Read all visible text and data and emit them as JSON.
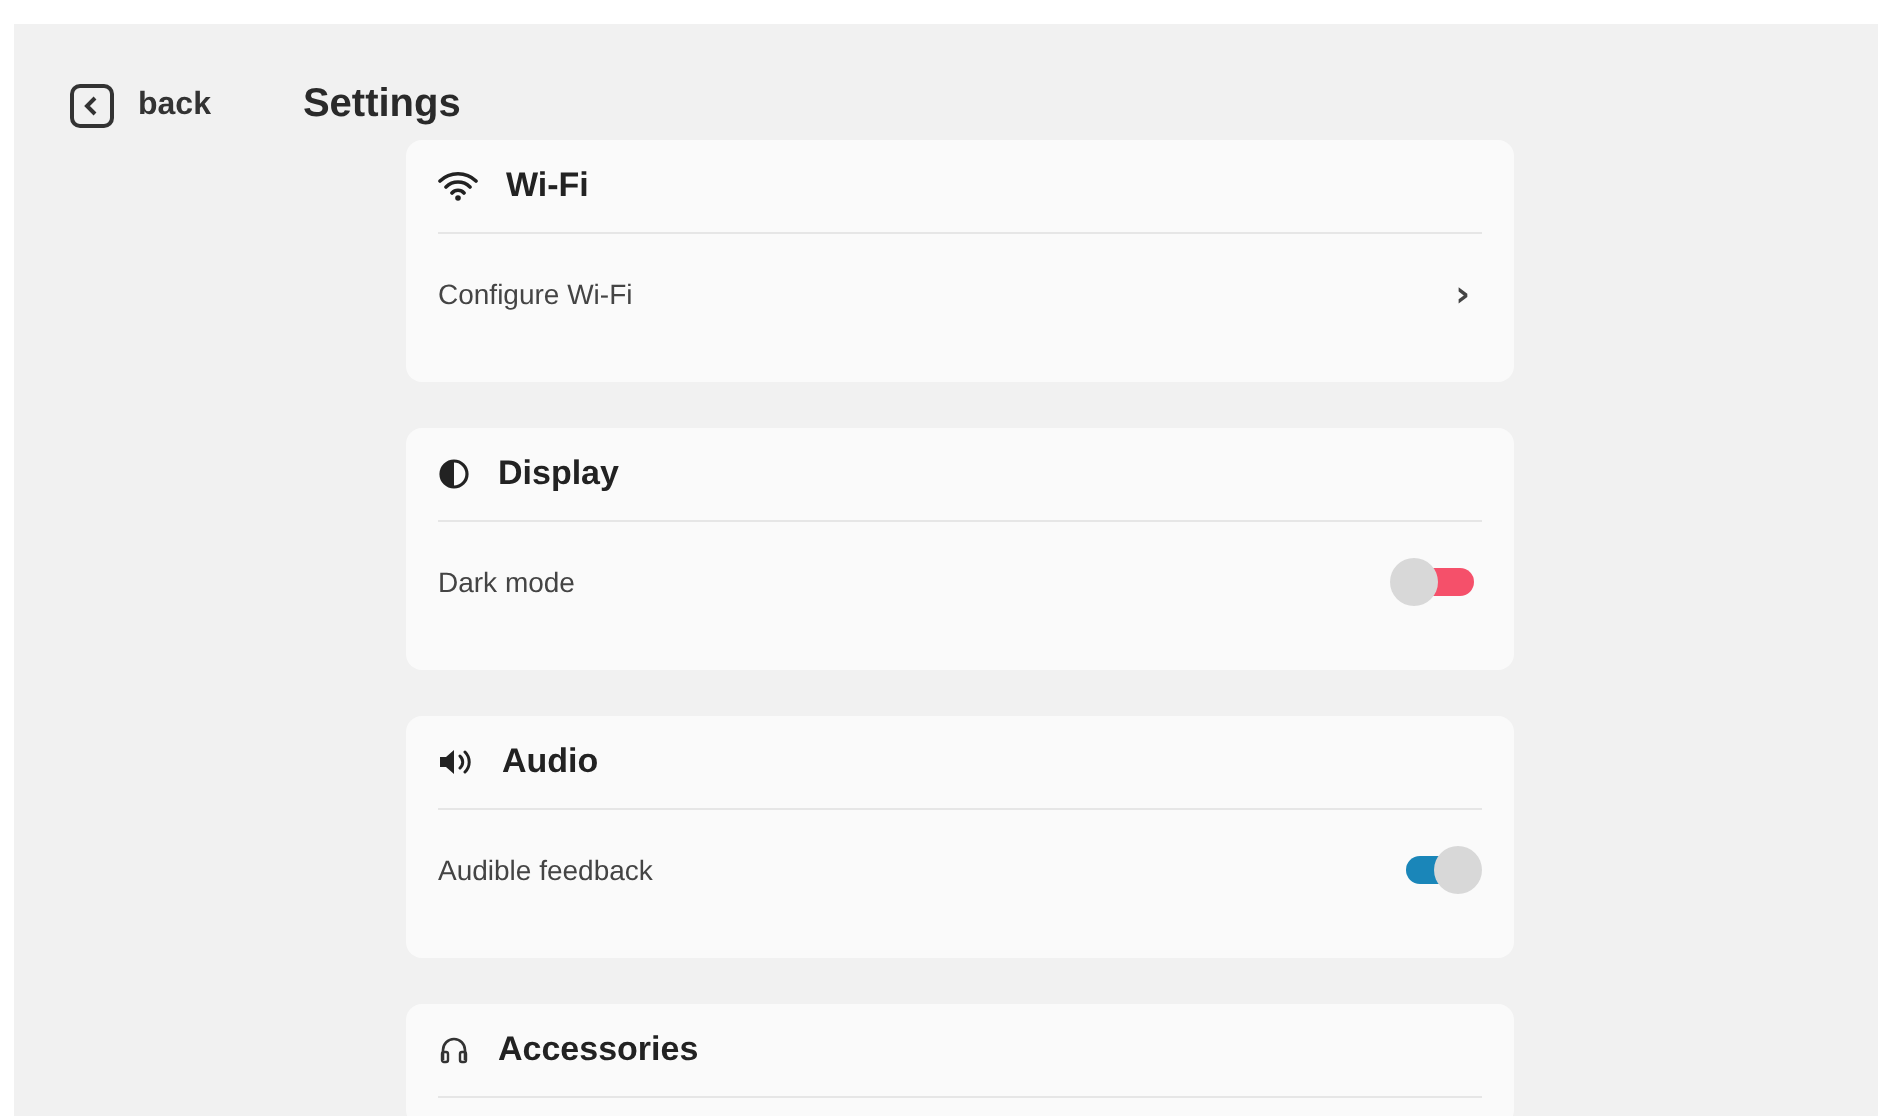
{
  "header": {
    "back_label": "back",
    "title": "Settings"
  },
  "sections": [
    {
      "title": "Wi-Fi",
      "kind": "wifi",
      "rows": [
        {
          "kind": "link",
          "label": "Configure Wi-Fi",
          "chevron": "›"
        }
      ]
    },
    {
      "title": "Display",
      "kind": "display",
      "rows": [
        {
          "kind": "toggle",
          "label": "Dark mode",
          "on": false
        }
      ]
    },
    {
      "title": "Audio",
      "kind": "audio",
      "rows": [
        {
          "kind": "toggle",
          "label": "Audible feedback",
          "on": true
        }
      ]
    },
    {
      "title": "Accessories",
      "kind": "accessories"
    }
  ]
}
